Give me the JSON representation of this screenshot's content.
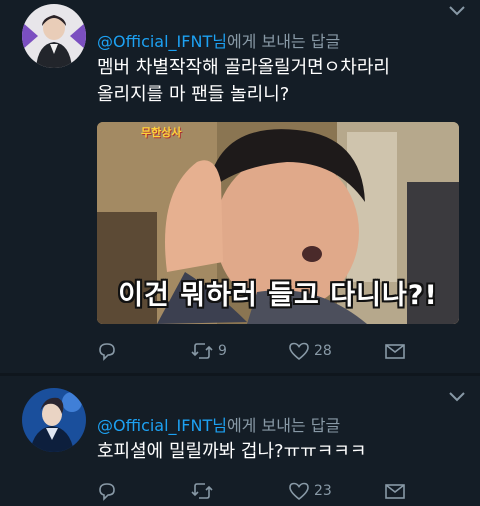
{
  "tweets": [
    {
      "reply_handle": "@Official_IFNT",
      "reply_suffix": "님",
      "reply_rest": "에게 보내는 답글",
      "text_line1": "멤버 차별작작해 골라올릴거면ㅇ차라리",
      "text_line2": "올리지를 마 팬들 놀리니?",
      "media": {
        "badge": "무한상사",
        "caption": "이건 뭐하러 들고 다니나?!"
      },
      "actions": {
        "reply_count": "",
        "retweet_count": "9",
        "like_count": "28"
      }
    },
    {
      "reply_handle": "@Official_IFNT",
      "reply_suffix": "님",
      "reply_rest": "에게 보내는 답글",
      "text_line1": "호피셜에 밀릴까봐 겁나?ㅠㅠㅋㅋㅋ",
      "actions": {
        "reply_count": "",
        "retweet_count": "",
        "like_count": "23"
      }
    }
  ],
  "colors": {
    "background": "#141d26",
    "link": "#1da1f2",
    "muted": "#8899a6",
    "text": "#ffffff"
  },
  "icons": [
    "chevron-down-icon",
    "reply-icon",
    "retweet-icon",
    "like-icon",
    "direct-message-icon"
  ]
}
